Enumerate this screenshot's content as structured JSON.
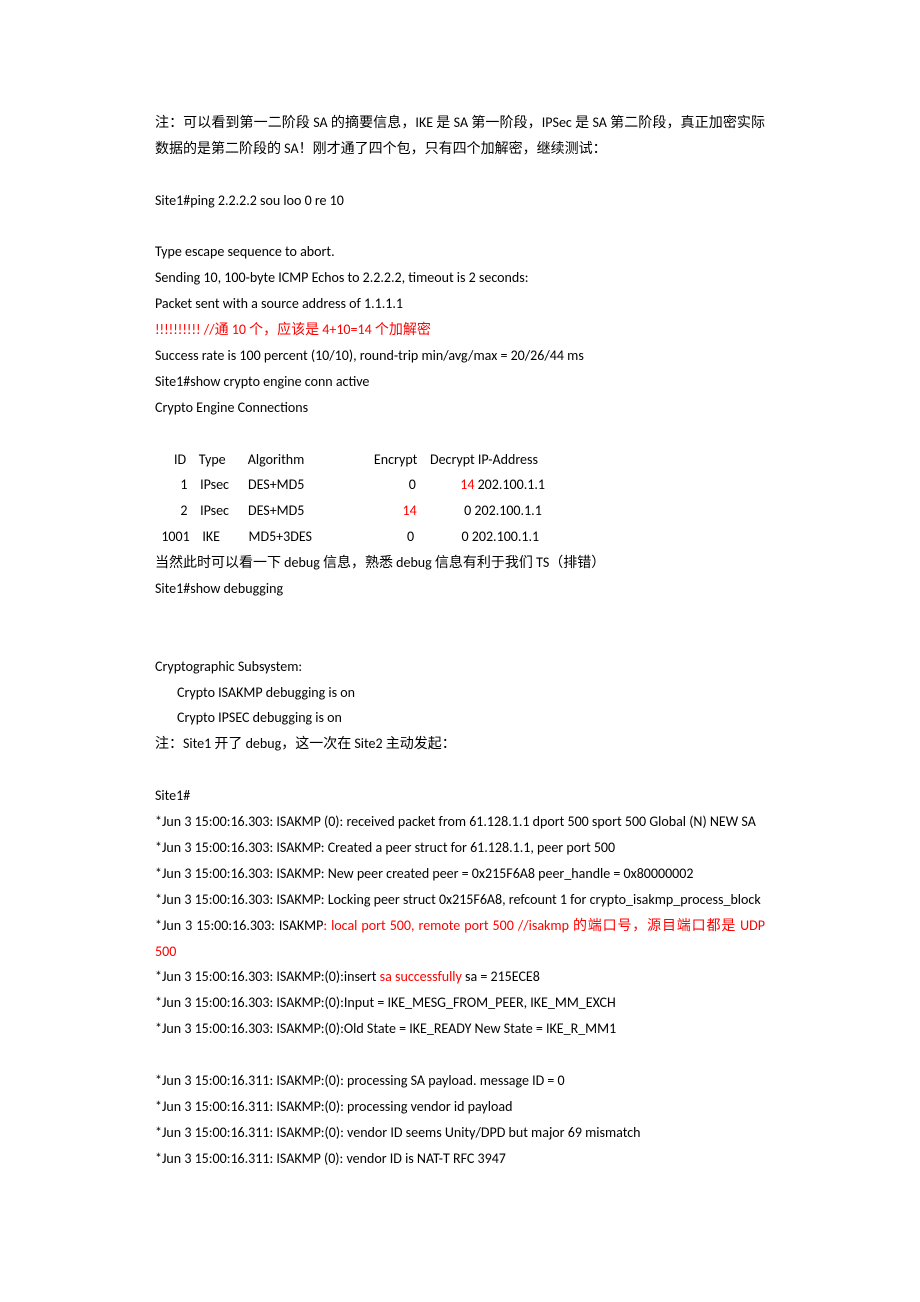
{
  "p1": "注：可以看到第一二阶段 SA 的摘要信息，IKE 是 SA 第一阶段，IPSec 是 SA 第二阶段，真正加密实际数据的是第二阶段的 SA！刚才通了四个包，只有四个加解密，继续测试：",
  "p2": "Site1#ping 2.2.2.2 sou loo 0 re 10",
  "p3": "Type escape sequence to abort.",
  "p4": "Sending 10, 100-byte ICMP Echos to 2.2.2.2, timeout is 2 seconds:",
  "p5": "Packet sent with a source address of 1.1.1.1",
  "p6": "!!!!!!!!!!      //通 10 个，应该是 4+10=14 个加解密",
  "p7": "Success rate is 100 percent (10/10), round-trip min/avg/max = 20/26/44 ms",
  "p8": "Site1#show crypto engine conn active",
  "p9": "Crypto Engine Connections",
  "thdr": "      ID    Type       Algorithm                      Encrypt    Decrypt IP-Address",
  "tr1a": "        1    IPsec      DES+MD5                                 0              ",
  "tr1b": "14",
  "tr1c": " 202.100.1.1",
  "tr2a": "        2    IPsec      DES+MD5                               ",
  "tr2b": "14",
  "tr2c": "               0 202.100.1.1",
  "tr3": "  1001    IKE         MD5+3DES                              0               0 202.100.1.1",
  "p10": "当然此时可以看一下 debug 信息，熟悉 debug 信息有利于我们 TS（排错）",
  "p11": "Site1#show debugging",
  "p12": "Cryptographic Subsystem:",
  "p13": "Crypto ISAKMP debugging is on",
  "p14": "Crypto IPSEC debugging is on",
  "p15": "注：Site1 开了 debug，这一次在 Site2 主动发起：",
  "p16": "Site1#",
  "p17a": "*Jun ",
  "p17b": " 3 15:00:16.303: ISAKMP (0): received packet from 61.128.1.1 dport 500 sport 500 Global (N) NEW SA",
  "p18": "*Jun    3 15:00:16.303: ISAKMP: Created a peer struct for 61.128.1.1, peer port 500",
  "p19": "*Jun    3 15:00:16.303: ISAKMP: New peer created peer = 0x215F6A8 peer_handle = 0x80000002",
  "p20": "*Jun     3   15:00:16.303:   ISAKMP:   Locking   peer   struct   0x215F6A8,   refcount   1   for crypto_isakmp_process_block",
  "p21a": "*Jun    3 15:00:16.303: ISAKMP",
  "p21b": ": local port 500, remote port 500 //isakmp 的端口号，源目端口都是 UDP 500",
  "p22a": "*Jun    3 15:00:16.303: ISAKMP:(0):insert ",
  "p22b": "sa successfully",
  "p22c": " sa = 215ECE8",
  "p23": "*Jun    3 15:00:16.303: ISAKMP:(0):Input = IKE_MESG_FROM_PEER, IKE_MM_EXCH",
  "p24": "*Jun    3 15:00:16.303: ISAKMP:(0):Old State = IKE_READY     New State = IKE_R_MM1",
  "p25": "*Jun    3 15:00:16.311: ISAKMP:(0): processing SA payload. message ID = 0",
  "p26": "*Jun    3 15:00:16.311: ISAKMP:(0): processing vendor id payload",
  "p27": "*Jun    3 15:00:16.311: ISAKMP:(0): vendor ID seems Unity/DPD but major 69 mismatch",
  "p28": "*Jun    3 15:00:16.311: ISAKMP (0): vendor ID is NAT-T RFC 3947"
}
